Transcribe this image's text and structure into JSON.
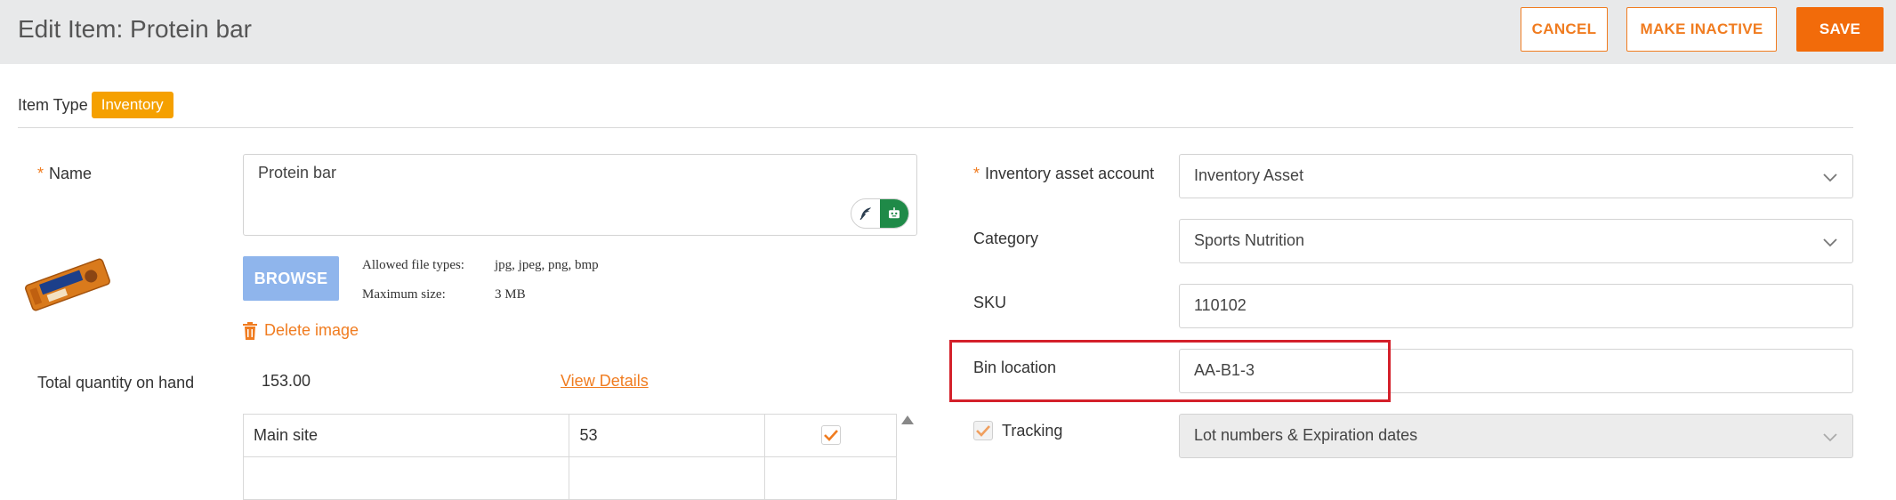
{
  "header": {
    "title": "Edit Item: Protein bar",
    "cancel_label": "CANCEL",
    "inactive_label": "MAKE INACTIVE",
    "save_label": "SAVE"
  },
  "item_type": {
    "label": "Item Type",
    "value": "Inventory"
  },
  "left": {
    "name_label": "Name",
    "name_value": "Protein bar",
    "browse_label": "BROWSE",
    "allowed_label": "Allowed file types:",
    "allowed_value": "jpg, jpeg, png, bmp",
    "max_label": "Maximum size:",
    "max_value": "3 MB",
    "delete_label": "Delete image",
    "qty_label": "Total quantity on hand",
    "qty_value": "153.00",
    "view_details": "View Details",
    "locations": [
      {
        "site": "Main site",
        "qty": "53",
        "checked": true
      }
    ]
  },
  "right": {
    "asset_label": "Inventory asset account",
    "asset_value": "Inventory Asset",
    "category_label": "Category",
    "category_value": "Sports Nutrition",
    "sku_label": "SKU",
    "sku_value": "110102",
    "bin_label": "Bin location",
    "bin_value": "AA-B1-3",
    "tracking_label": "Tracking",
    "tracking_value": "Lot numbers & Expiration dates"
  },
  "colors": {
    "accent": "#f07c20",
    "badge": "#f5a000",
    "highlight": "#d4202a",
    "browse": "#8fb5ec",
    "ai_green": "#1f8a48"
  },
  "icons": [
    "trash-icon",
    "chevron-down-icon",
    "checkmark-icon",
    "feather-icon",
    "robot-icon",
    "scroll-up-arrow-icon"
  ]
}
